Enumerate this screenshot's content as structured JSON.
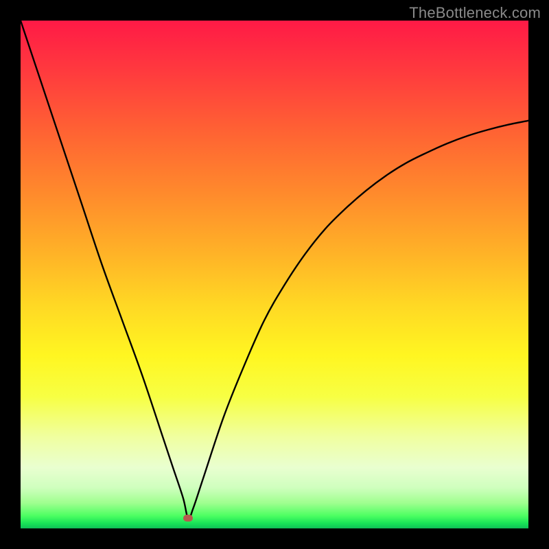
{
  "watermark": "TheBottleneck.com",
  "colors": {
    "frame": "#000000",
    "curve": "#000000",
    "marker": "#b65a4e",
    "gradient_top": "#ff1a46",
    "gradient_bottom": "#0fbf57"
  },
  "chart_data": {
    "type": "line",
    "title": "",
    "xlabel": "",
    "ylabel": "",
    "xlim": [
      0,
      100
    ],
    "ylim": [
      0,
      100
    ],
    "grid": false,
    "legend": false,
    "marker": {
      "x": 33,
      "y": 2
    },
    "series": [
      {
        "name": "bottleneck-curve",
        "x": [
          0,
          4,
          8,
          12,
          16,
          20,
          24,
          28,
          30,
          32,
          33,
          34,
          36,
          40,
          44,
          48,
          52,
          56,
          60,
          64,
          68,
          72,
          76,
          80,
          84,
          88,
          92,
          96,
          100
        ],
        "values": [
          100,
          88,
          76,
          64,
          52,
          41,
          30,
          18,
          12,
          6,
          2,
          4,
          10,
          22,
          32,
          41,
          48,
          54,
          59,
          63,
          66.5,
          69.5,
          72,
          74,
          75.8,
          77.3,
          78.5,
          79.5,
          80.3
        ]
      }
    ]
  }
}
